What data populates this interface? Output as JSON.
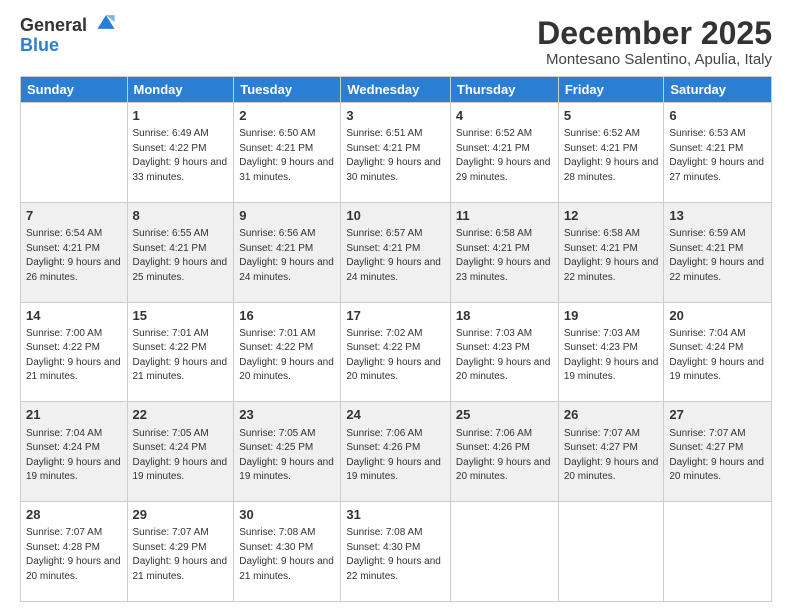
{
  "logo": {
    "general": "General",
    "blue": "Blue"
  },
  "header": {
    "month": "December 2025",
    "location": "Montesano Salentino, Apulia, Italy"
  },
  "weekdays": [
    "Sunday",
    "Monday",
    "Tuesday",
    "Wednesday",
    "Thursday",
    "Friday",
    "Saturday"
  ],
  "weeks": [
    [
      {
        "num": "",
        "sunrise": "",
        "sunset": "",
        "daylight": "",
        "empty": true
      },
      {
        "num": "1",
        "sunrise": "Sunrise: 6:49 AM",
        "sunset": "Sunset: 4:22 PM",
        "daylight": "Daylight: 9 hours and 33 minutes."
      },
      {
        "num": "2",
        "sunrise": "Sunrise: 6:50 AM",
        "sunset": "Sunset: 4:21 PM",
        "daylight": "Daylight: 9 hours and 31 minutes."
      },
      {
        "num": "3",
        "sunrise": "Sunrise: 6:51 AM",
        "sunset": "Sunset: 4:21 PM",
        "daylight": "Daylight: 9 hours and 30 minutes."
      },
      {
        "num": "4",
        "sunrise": "Sunrise: 6:52 AM",
        "sunset": "Sunset: 4:21 PM",
        "daylight": "Daylight: 9 hours and 29 minutes."
      },
      {
        "num": "5",
        "sunrise": "Sunrise: 6:52 AM",
        "sunset": "Sunset: 4:21 PM",
        "daylight": "Daylight: 9 hours and 28 minutes."
      },
      {
        "num": "6",
        "sunrise": "Sunrise: 6:53 AM",
        "sunset": "Sunset: 4:21 PM",
        "daylight": "Daylight: 9 hours and 27 minutes."
      }
    ],
    [
      {
        "num": "7",
        "sunrise": "Sunrise: 6:54 AM",
        "sunset": "Sunset: 4:21 PM",
        "daylight": "Daylight: 9 hours and 26 minutes."
      },
      {
        "num": "8",
        "sunrise": "Sunrise: 6:55 AM",
        "sunset": "Sunset: 4:21 PM",
        "daylight": "Daylight: 9 hours and 25 minutes."
      },
      {
        "num": "9",
        "sunrise": "Sunrise: 6:56 AM",
        "sunset": "Sunset: 4:21 PM",
        "daylight": "Daylight: 9 hours and 24 minutes."
      },
      {
        "num": "10",
        "sunrise": "Sunrise: 6:57 AM",
        "sunset": "Sunset: 4:21 PM",
        "daylight": "Daylight: 9 hours and 24 minutes."
      },
      {
        "num": "11",
        "sunrise": "Sunrise: 6:58 AM",
        "sunset": "Sunset: 4:21 PM",
        "daylight": "Daylight: 9 hours and 23 minutes."
      },
      {
        "num": "12",
        "sunrise": "Sunrise: 6:58 AM",
        "sunset": "Sunset: 4:21 PM",
        "daylight": "Daylight: 9 hours and 22 minutes."
      },
      {
        "num": "13",
        "sunrise": "Sunrise: 6:59 AM",
        "sunset": "Sunset: 4:21 PM",
        "daylight": "Daylight: 9 hours and 22 minutes."
      }
    ],
    [
      {
        "num": "14",
        "sunrise": "Sunrise: 7:00 AM",
        "sunset": "Sunset: 4:22 PM",
        "daylight": "Daylight: 9 hours and 21 minutes."
      },
      {
        "num": "15",
        "sunrise": "Sunrise: 7:01 AM",
        "sunset": "Sunset: 4:22 PM",
        "daylight": "Daylight: 9 hours and 21 minutes."
      },
      {
        "num": "16",
        "sunrise": "Sunrise: 7:01 AM",
        "sunset": "Sunset: 4:22 PM",
        "daylight": "Daylight: 9 hours and 20 minutes."
      },
      {
        "num": "17",
        "sunrise": "Sunrise: 7:02 AM",
        "sunset": "Sunset: 4:22 PM",
        "daylight": "Daylight: 9 hours and 20 minutes."
      },
      {
        "num": "18",
        "sunrise": "Sunrise: 7:03 AM",
        "sunset": "Sunset: 4:23 PM",
        "daylight": "Daylight: 9 hours and 20 minutes."
      },
      {
        "num": "19",
        "sunrise": "Sunrise: 7:03 AM",
        "sunset": "Sunset: 4:23 PM",
        "daylight": "Daylight: 9 hours and 19 minutes."
      },
      {
        "num": "20",
        "sunrise": "Sunrise: 7:04 AM",
        "sunset": "Sunset: 4:24 PM",
        "daylight": "Daylight: 9 hours and 19 minutes."
      }
    ],
    [
      {
        "num": "21",
        "sunrise": "Sunrise: 7:04 AM",
        "sunset": "Sunset: 4:24 PM",
        "daylight": "Daylight: 9 hours and 19 minutes."
      },
      {
        "num": "22",
        "sunrise": "Sunrise: 7:05 AM",
        "sunset": "Sunset: 4:24 PM",
        "daylight": "Daylight: 9 hours and 19 minutes."
      },
      {
        "num": "23",
        "sunrise": "Sunrise: 7:05 AM",
        "sunset": "Sunset: 4:25 PM",
        "daylight": "Daylight: 9 hours and 19 minutes."
      },
      {
        "num": "24",
        "sunrise": "Sunrise: 7:06 AM",
        "sunset": "Sunset: 4:26 PM",
        "daylight": "Daylight: 9 hours and 19 minutes."
      },
      {
        "num": "25",
        "sunrise": "Sunrise: 7:06 AM",
        "sunset": "Sunset: 4:26 PM",
        "daylight": "Daylight: 9 hours and 20 minutes."
      },
      {
        "num": "26",
        "sunrise": "Sunrise: 7:07 AM",
        "sunset": "Sunset: 4:27 PM",
        "daylight": "Daylight: 9 hours and 20 minutes."
      },
      {
        "num": "27",
        "sunrise": "Sunrise: 7:07 AM",
        "sunset": "Sunset: 4:27 PM",
        "daylight": "Daylight: 9 hours and 20 minutes."
      }
    ],
    [
      {
        "num": "28",
        "sunrise": "Sunrise: 7:07 AM",
        "sunset": "Sunset: 4:28 PM",
        "daylight": "Daylight: 9 hours and 20 minutes."
      },
      {
        "num": "29",
        "sunrise": "Sunrise: 7:07 AM",
        "sunset": "Sunset: 4:29 PM",
        "daylight": "Daylight: 9 hours and 21 minutes."
      },
      {
        "num": "30",
        "sunrise": "Sunrise: 7:08 AM",
        "sunset": "Sunset: 4:30 PM",
        "daylight": "Daylight: 9 hours and 21 minutes."
      },
      {
        "num": "31",
        "sunrise": "Sunrise: 7:08 AM",
        "sunset": "Sunset: 4:30 PM",
        "daylight": "Daylight: 9 hours and 22 minutes."
      },
      {
        "num": "",
        "sunrise": "",
        "sunset": "",
        "daylight": "",
        "empty": true
      },
      {
        "num": "",
        "sunrise": "",
        "sunset": "",
        "daylight": "",
        "empty": true
      },
      {
        "num": "",
        "sunrise": "",
        "sunset": "",
        "daylight": "",
        "empty": true
      }
    ]
  ]
}
